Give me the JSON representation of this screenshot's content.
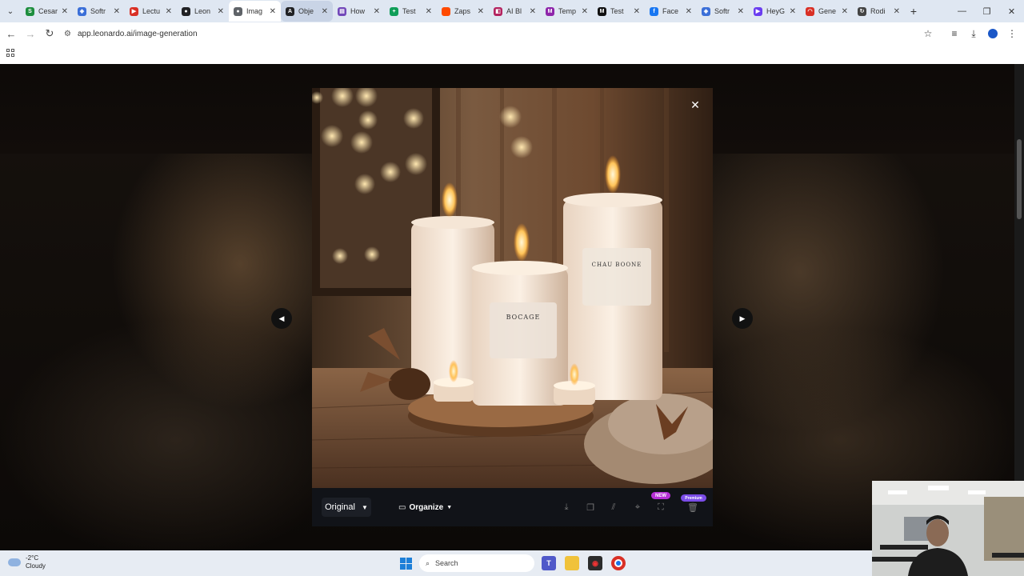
{
  "browser": {
    "tabs": [
      {
        "title": "Cesar",
        "color": "#1e8e3e",
        "glyph": "S",
        "state": "normal"
      },
      {
        "title": "Softr",
        "color": "#3b6fd8",
        "glyph": "◈",
        "state": "normal"
      },
      {
        "title": "Lectu",
        "color": "#d93025",
        "glyph": "▶",
        "state": "normal"
      },
      {
        "title": "Leon",
        "color": "#202124",
        "glyph": "●",
        "state": "normal"
      },
      {
        "title": "Imag",
        "color": "#5f6368",
        "glyph": "●",
        "state": "active"
      },
      {
        "title": "Obje",
        "color": "#202124",
        "glyph": "A",
        "state": "hover"
      },
      {
        "title": "How",
        "color": "#7248b9",
        "glyph": "▤",
        "state": "normal"
      },
      {
        "title": "Test",
        "color": "#0f9d58",
        "glyph": "+",
        "state": "normal"
      },
      {
        "title": "Zaps",
        "color": "#ff4a00",
        "glyph": "",
        "state": "normal"
      },
      {
        "title": "AI Bl",
        "color": "#b4235f",
        "glyph": "◧",
        "state": "normal"
      },
      {
        "title": "Temp",
        "color": "#8e24aa",
        "glyph": "M",
        "state": "normal"
      },
      {
        "title": "Test",
        "color": "#111111",
        "glyph": "M",
        "state": "normal"
      },
      {
        "title": "Face",
        "color": "#1877f2",
        "glyph": "f",
        "state": "normal"
      },
      {
        "title": "Softr",
        "color": "#3b6fd8",
        "glyph": "◈",
        "state": "normal"
      },
      {
        "title": "HeyG",
        "color": "#6a3df0",
        "glyph": "▶",
        "state": "normal"
      },
      {
        "title": "Gene",
        "color": "#d93025",
        "glyph": "◠",
        "state": "normal"
      },
      {
        "title": "Rodi",
        "color": "#444444",
        "glyph": "↻",
        "state": "normal"
      }
    ],
    "url": "app.leonardo.ai/image-generation"
  },
  "viewer": {
    "label_left": "BOCAGE",
    "label_right": "CHAU BOONE",
    "version_select": "Original",
    "organize_label": "Organize",
    "badge_new": "NEW",
    "badge_premium": "Premium"
  },
  "taskbar": {
    "temperature": "-2°C",
    "condition": "Cloudy",
    "search_placeholder": "Search"
  }
}
